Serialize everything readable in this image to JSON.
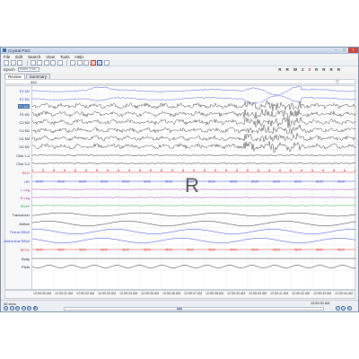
{
  "window": {
    "title": "Crystal PSG"
  },
  "menu": [
    "File",
    "Edit",
    "Search",
    "View",
    "Tools",
    "Help"
  ],
  "toolbar2": {
    "epoch_label": "Epoch",
    "epoch_value": "Wake Trial",
    "stages": [
      "R",
      "R",
      "W",
      "2",
      "3",
      "R",
      "R",
      "R",
      "R"
    ],
    "highlight_index": 4
  },
  "tabs": [
    {
      "label": "Review"
    },
    {
      "label": "Summary"
    }
  ],
  "hypnogram": {
    "epoch_number": "349",
    "marker": "▽"
  },
  "channels": [
    {
      "label": "E1 M2",
      "color": "#2b3cd1"
    },
    {
      "label": "E2 M1",
      "color": "#2b3cd1"
    },
    {
      "label": "F3 M2",
      "color": "#222222",
      "selected": true
    },
    {
      "label": "F4 M1",
      "color": "#222222"
    },
    {
      "label": "C3 M2",
      "color": "#222222"
    },
    {
      "label": "C4 M1",
      "color": "#222222"
    },
    {
      "label": "O1 M2",
      "color": "#222222"
    },
    {
      "label": "O2 M1",
      "color": "#222222"
    },
    {
      "label": "Chin 1-2",
      "color": "#222222"
    },
    {
      "label": "Chin 3-2",
      "color": "#222222"
    },
    {
      "label": "EKG",
      "color": "#d0312d"
    },
    {
      "label": "HR",
      "color": "#2b3cd1"
    },
    {
      "label": "L Leg",
      "color": "#a02fa8"
    },
    {
      "label": "R Leg",
      "color": "#a02fa8"
    },
    {
      "label": "Snore",
      "color": "#2e9e3a"
    },
    {
      "label": "Transducer",
      "color": "#222222"
    },
    {
      "label": "Airflow",
      "color": "#222222"
    },
    {
      "label": "Thorax Effort",
      "color": "#2b3cd1"
    },
    {
      "label": "Abdominal Effort",
      "color": "#2b3cd1"
    },
    {
      "label": "SPO2",
      "color": "#d0312d"
    },
    {
      "label": "Body",
      "color": "#222222"
    },
    {
      "label": "Pleth",
      "color": "#222222"
    }
  ],
  "stage_overlay": "R",
  "hr_row_value": "64.00",
  "spo2_row_value": "98.00",
  "times": [
    "12:59:30 AM",
    "12:59:31 AM",
    "12:59:32 AM",
    "12:59:33 AM",
    "12:59:34 AM",
    "12:59:35 AM",
    "12:59:36 AM",
    "12:59:37 AM",
    "12:59:38 AM",
    "12:59:39 AM",
    "12:59:40 AM",
    "12:59:41 AM",
    "12:59:42 AM",
    "12:59:43 AM",
    "12:59:44 AM"
  ],
  "bottom": {
    "epoch_size_label": "30 secs",
    "clock": "12:59:30 AM"
  },
  "colors": {
    "eeg": "#222222",
    "eog": "#2b3cd1",
    "ekg": "#d0312d",
    "leg": "#a02fa8",
    "snore": "#2e9e3a"
  }
}
